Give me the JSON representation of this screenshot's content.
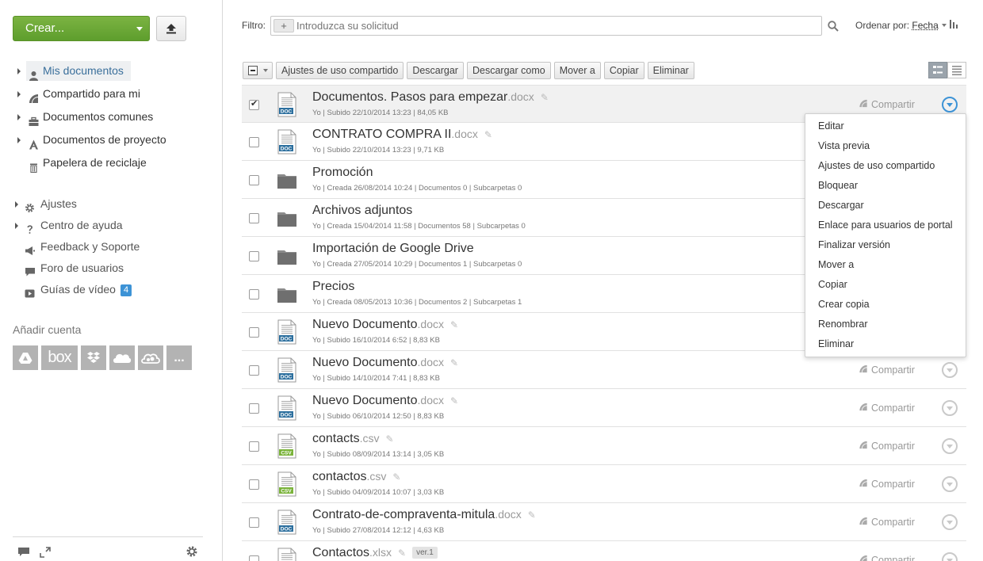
{
  "sidebar": {
    "create_label": "Crear...",
    "nav": [
      {
        "label": "Mis documentos",
        "icon": "user-icon",
        "active": true
      },
      {
        "label": "Compartido para mi",
        "icon": "share-icon"
      },
      {
        "label": "Documentos comunes",
        "icon": "briefcase-icon"
      },
      {
        "label": "Documentos de proyecto",
        "icon": "project-icon"
      },
      {
        "label": "Papelera de reciclaje",
        "icon": "trash-icon"
      }
    ],
    "nav2": [
      {
        "label": "Ajustes",
        "icon": "gear-icon"
      },
      {
        "label": "Centro de ayuda",
        "icon": "help-icon"
      },
      {
        "label": "Feedback y Soporte",
        "icon": "megaphone-icon"
      },
      {
        "label": "Foro de usuarios",
        "icon": "chat-icon"
      },
      {
        "label": "Guías de vídeo",
        "icon": "video-icon",
        "badge": "4"
      }
    ],
    "add_account_label": "Añadir cuenta",
    "accounts": [
      "google-drive-icon",
      "box-icon",
      "dropbox-icon",
      "onedrive-icon",
      "owncloud-icon",
      "more-icon"
    ],
    "accounts_text": {
      "box": "box",
      "more": "..."
    }
  },
  "filter": {
    "label": "Filtro:",
    "plus": "+",
    "placeholder": "Introduzca su solicitud"
  },
  "sort": {
    "label": "Ordenar por:",
    "value": "Fecha"
  },
  "toolbar": {
    "buttons": [
      "Ajustes de uso compartido",
      "Descargar",
      "Descargar como",
      "Mover a",
      "Copiar",
      "Eliminar"
    ]
  },
  "share_label": "Compartir",
  "files": [
    {
      "name": "Documentos. Pasos para empezar",
      "ext": ".docx",
      "type": "doc",
      "meta": "Yo | Subido 22/10/2014 13:23 | 84,05 KB",
      "checked": true,
      "editable": true
    },
    {
      "name": "CONTRATO COMPRA II",
      "ext": ".docx",
      "type": "doc",
      "meta": "Yo | Subido 22/10/2014 13:23 | 9,71 KB",
      "editable": true
    },
    {
      "name": "Promoción",
      "ext": "",
      "type": "folder",
      "meta": "Yo | Creada 26/08/2014 10:24 | Documentos  0 | Subcarpetas 0"
    },
    {
      "name": "Archivos adjuntos",
      "ext": "",
      "type": "folder",
      "meta": "Yo | Creada 15/04/2014 11:58 | Documentos  58 | Subcarpetas 0"
    },
    {
      "name": "Importación de Google Drive",
      "ext": "",
      "type": "folder",
      "meta": "Yo | Creada 27/05/2014 10:29 | Documentos  1 | Subcarpetas 0"
    },
    {
      "name": "Precios",
      "ext": "",
      "type": "folder",
      "meta": "Yo | Creada 08/05/2013 10:36 | Documentos  2 | Subcarpetas 1"
    },
    {
      "name": "Nuevo Documento",
      "ext": ".docx",
      "type": "doc",
      "meta": "Yo | Subido 16/10/2014 6:52 | 8,83 KB",
      "editable": true
    },
    {
      "name": "Nuevo Documento",
      "ext": ".docx",
      "type": "doc",
      "meta": "Yo | Subido 14/10/2014 7:41 | 8,83 KB",
      "editable": true,
      "share": true
    },
    {
      "name": "Nuevo Documento",
      "ext": ".docx",
      "type": "doc",
      "meta": "Yo | Subido 06/10/2014 12:50 | 8,83 KB",
      "editable": true,
      "share": true
    },
    {
      "name": "contacts",
      "ext": ".csv",
      "type": "csv",
      "meta": "Yo | Subido 08/09/2014 13:14 | 3,05 KB",
      "editable": true,
      "share": true
    },
    {
      "name": "contactos",
      "ext": ".csv",
      "type": "csv",
      "meta": "Yo | Subido 04/09/2014 10:07 | 3,03 KB",
      "editable": true,
      "share": true
    },
    {
      "name": "Contrato-de-compraventa-mitula",
      "ext": ".docx",
      "type": "doc",
      "meta": "Yo | Subido 27/08/2014 12:12 | 4,63 KB",
      "editable": true,
      "share": true
    },
    {
      "name": "Contactos",
      "ext": ".xlsx",
      "type": "xls",
      "meta": "",
      "editable": true,
      "version": "ver.1",
      "share": true
    }
  ],
  "context_menu": [
    "Editar",
    "Vista previa",
    "Ajustes de uso compartido",
    "Bloquear",
    "Descargar",
    "Enlace para usuarios de portal",
    "Finalizar versión",
    "Mover a",
    "Copiar",
    "Crear copia",
    "Renombrar",
    "Eliminar"
  ],
  "colors": {
    "accent": "#3d93d6",
    "create": "#6aa832"
  }
}
